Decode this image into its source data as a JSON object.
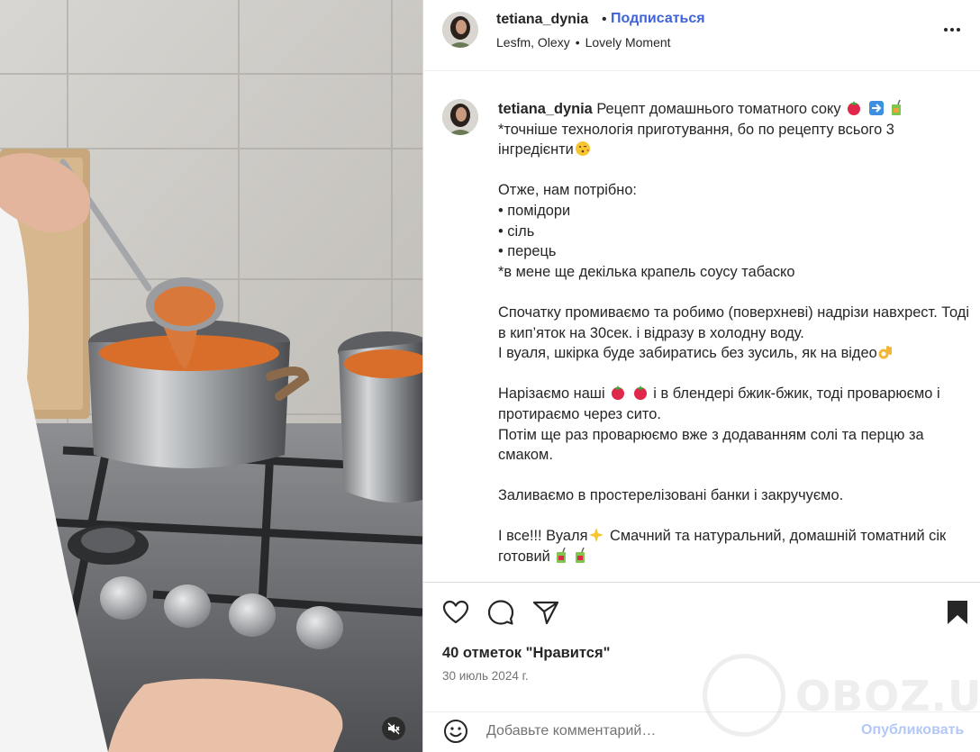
{
  "header": {
    "username": "tetiana_dynia",
    "separator": "•",
    "follow_label": "Подписаться",
    "audio_artist": "Lesfm, Olexy",
    "audio_separator": "•",
    "audio_track": "Lovely Moment"
  },
  "caption": {
    "username": "tetiana_dynia",
    "line1": "Рецепт домашнього томатного соку",
    "line2": "*точніше технологія приготування, бо по рецепту всього 3 інгредієнти",
    "line3": "Отже, нам потрібно:",
    "line4": "• помідори",
    "line5": "• сіль",
    "line6": "• перець",
    "line7": "*в мене ще декілька крапель соусу табаско",
    "line8": "Спочатку промиваємо та робимо (поверхневі) надрізи навхрест. Тоді в кип’яток на 30сек. і відразу в холодну воду.",
    "line9": "І вуаля, шкірка буде забиратись без зусиль, як на відео",
    "line10a": "Нарізаємо наші",
    "line10b": "і в блендері бжик-бжик, тоді проварюємо і протираємо через сито.",
    "line11": "Потім ще раз проварюємо вже з додаванням солі та перцю за смаком.",
    "line12": "Заливаємо в простерелізовані банки і закручуємо.",
    "line13a": "І все!!! Вуаля",
    "line13b": "Смачний та натуральний, домашній томатний сік готовий"
  },
  "actions": {
    "likes": "40 отметок \"Нравится\"",
    "date": "30 июль 2024 г."
  },
  "comment": {
    "placeholder": "Добавьте комментарий…",
    "post_label": "Опубликовать"
  },
  "watermark": {
    "text": "OBOZ.UA"
  },
  "icons": {
    "like": "heart-icon",
    "comment": "speech-bubble-icon",
    "share": "paper-plane-icon",
    "save": "bookmark-icon",
    "more": "more-dots-icon",
    "emoji": "smiley-icon",
    "mute": "speaker-muted-icon"
  }
}
